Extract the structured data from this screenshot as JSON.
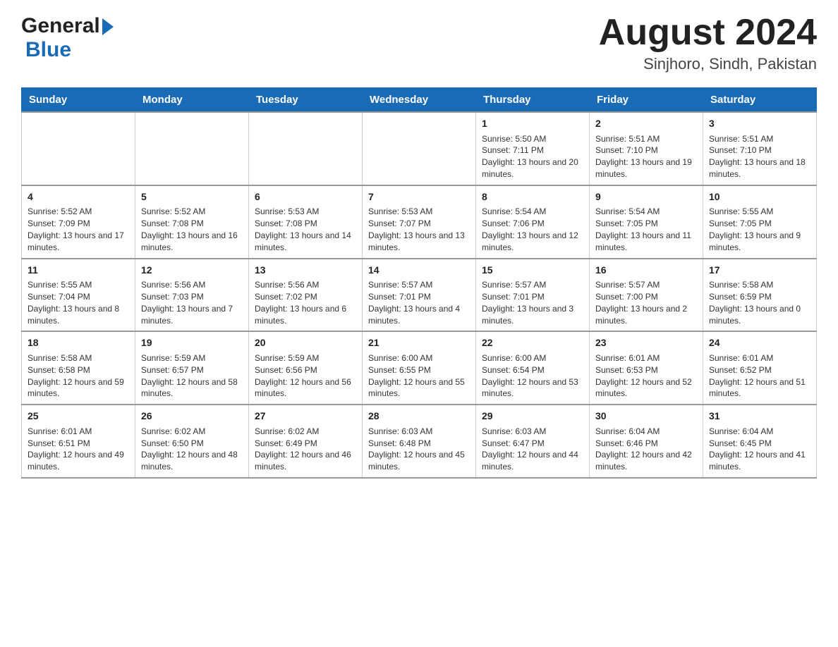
{
  "header": {
    "logo_general": "General",
    "logo_blue": "Blue",
    "title": "August 2024",
    "location": "Sinjhoro, Sindh, Pakistan"
  },
  "days_of_week": [
    "Sunday",
    "Monday",
    "Tuesday",
    "Wednesday",
    "Thursday",
    "Friday",
    "Saturday"
  ],
  "weeks": [
    {
      "days": [
        {
          "number": "",
          "info": ""
        },
        {
          "number": "",
          "info": ""
        },
        {
          "number": "",
          "info": ""
        },
        {
          "number": "",
          "info": ""
        },
        {
          "number": "1",
          "info": "Sunrise: 5:50 AM\nSunset: 7:11 PM\nDaylight: 13 hours and 20 minutes."
        },
        {
          "number": "2",
          "info": "Sunrise: 5:51 AM\nSunset: 7:10 PM\nDaylight: 13 hours and 19 minutes."
        },
        {
          "number": "3",
          "info": "Sunrise: 5:51 AM\nSunset: 7:10 PM\nDaylight: 13 hours and 18 minutes."
        }
      ]
    },
    {
      "days": [
        {
          "number": "4",
          "info": "Sunrise: 5:52 AM\nSunset: 7:09 PM\nDaylight: 13 hours and 17 minutes."
        },
        {
          "number": "5",
          "info": "Sunrise: 5:52 AM\nSunset: 7:08 PM\nDaylight: 13 hours and 16 minutes."
        },
        {
          "number": "6",
          "info": "Sunrise: 5:53 AM\nSunset: 7:08 PM\nDaylight: 13 hours and 14 minutes."
        },
        {
          "number": "7",
          "info": "Sunrise: 5:53 AM\nSunset: 7:07 PM\nDaylight: 13 hours and 13 minutes."
        },
        {
          "number": "8",
          "info": "Sunrise: 5:54 AM\nSunset: 7:06 PM\nDaylight: 13 hours and 12 minutes."
        },
        {
          "number": "9",
          "info": "Sunrise: 5:54 AM\nSunset: 7:05 PM\nDaylight: 13 hours and 11 minutes."
        },
        {
          "number": "10",
          "info": "Sunrise: 5:55 AM\nSunset: 7:05 PM\nDaylight: 13 hours and 9 minutes."
        }
      ]
    },
    {
      "days": [
        {
          "number": "11",
          "info": "Sunrise: 5:55 AM\nSunset: 7:04 PM\nDaylight: 13 hours and 8 minutes."
        },
        {
          "number": "12",
          "info": "Sunrise: 5:56 AM\nSunset: 7:03 PM\nDaylight: 13 hours and 7 minutes."
        },
        {
          "number": "13",
          "info": "Sunrise: 5:56 AM\nSunset: 7:02 PM\nDaylight: 13 hours and 6 minutes."
        },
        {
          "number": "14",
          "info": "Sunrise: 5:57 AM\nSunset: 7:01 PM\nDaylight: 13 hours and 4 minutes."
        },
        {
          "number": "15",
          "info": "Sunrise: 5:57 AM\nSunset: 7:01 PM\nDaylight: 13 hours and 3 minutes."
        },
        {
          "number": "16",
          "info": "Sunrise: 5:57 AM\nSunset: 7:00 PM\nDaylight: 13 hours and 2 minutes."
        },
        {
          "number": "17",
          "info": "Sunrise: 5:58 AM\nSunset: 6:59 PM\nDaylight: 13 hours and 0 minutes."
        }
      ]
    },
    {
      "days": [
        {
          "number": "18",
          "info": "Sunrise: 5:58 AM\nSunset: 6:58 PM\nDaylight: 12 hours and 59 minutes."
        },
        {
          "number": "19",
          "info": "Sunrise: 5:59 AM\nSunset: 6:57 PM\nDaylight: 12 hours and 58 minutes."
        },
        {
          "number": "20",
          "info": "Sunrise: 5:59 AM\nSunset: 6:56 PM\nDaylight: 12 hours and 56 minutes."
        },
        {
          "number": "21",
          "info": "Sunrise: 6:00 AM\nSunset: 6:55 PM\nDaylight: 12 hours and 55 minutes."
        },
        {
          "number": "22",
          "info": "Sunrise: 6:00 AM\nSunset: 6:54 PM\nDaylight: 12 hours and 53 minutes."
        },
        {
          "number": "23",
          "info": "Sunrise: 6:01 AM\nSunset: 6:53 PM\nDaylight: 12 hours and 52 minutes."
        },
        {
          "number": "24",
          "info": "Sunrise: 6:01 AM\nSunset: 6:52 PM\nDaylight: 12 hours and 51 minutes."
        }
      ]
    },
    {
      "days": [
        {
          "number": "25",
          "info": "Sunrise: 6:01 AM\nSunset: 6:51 PM\nDaylight: 12 hours and 49 minutes."
        },
        {
          "number": "26",
          "info": "Sunrise: 6:02 AM\nSunset: 6:50 PM\nDaylight: 12 hours and 48 minutes."
        },
        {
          "number": "27",
          "info": "Sunrise: 6:02 AM\nSunset: 6:49 PM\nDaylight: 12 hours and 46 minutes."
        },
        {
          "number": "28",
          "info": "Sunrise: 6:03 AM\nSunset: 6:48 PM\nDaylight: 12 hours and 45 minutes."
        },
        {
          "number": "29",
          "info": "Sunrise: 6:03 AM\nSunset: 6:47 PM\nDaylight: 12 hours and 44 minutes."
        },
        {
          "number": "30",
          "info": "Sunrise: 6:04 AM\nSunset: 6:46 PM\nDaylight: 12 hours and 42 minutes."
        },
        {
          "number": "31",
          "info": "Sunrise: 6:04 AM\nSunset: 6:45 PM\nDaylight: 12 hours and 41 minutes."
        }
      ]
    }
  ]
}
